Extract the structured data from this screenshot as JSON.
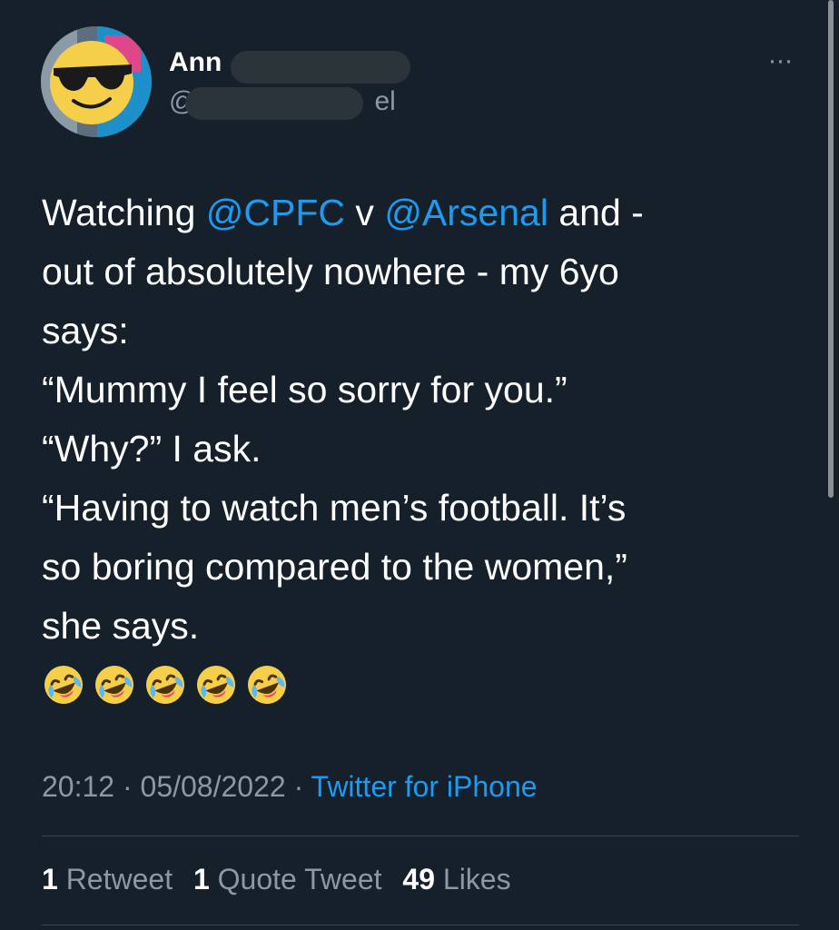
{
  "author": {
    "display_name": "Ann",
    "handle_prefix": "@",
    "handle_suffix": "el"
  },
  "more_icon": "···",
  "tweet": {
    "lines": [
      [
        {
          "t": "Watching ",
          "m": false
        },
        {
          "t": "@CPFC",
          "m": true
        },
        {
          "t": " v ",
          "m": false
        },
        {
          "t": "@Arsenal",
          "m": true
        },
        {
          "t": " and -",
          "m": false
        }
      ],
      [
        {
          "t": "out of absolutely nowhere - my 6yo",
          "m": false
        }
      ],
      [
        {
          "t": "says:",
          "m": false
        }
      ],
      [
        {
          "t": "“Mummy I feel so sorry for you.”",
          "m": false
        }
      ],
      [
        {
          "t": "“Why?” I ask.",
          "m": false
        }
      ],
      [
        {
          "t": "“Having to watch men’s football. It’s",
          "m": false
        }
      ],
      [
        {
          "t": "so boring compared to the women,”",
          "m": false
        }
      ],
      [
        {
          "t": "she says.",
          "m": false
        }
      ]
    ],
    "emoji": [
      "rolling-on-floor-laughing",
      "rolling-on-floor-laughing",
      "rolling-on-floor-laughing",
      "rolling-on-floor-laughing",
      "rolling-on-floor-laughing"
    ]
  },
  "meta": {
    "time": "20:12",
    "sep1": " · ",
    "date": "05/08/2022",
    "sep2": " · ",
    "source": "Twitter for iPhone"
  },
  "stats": {
    "retweets_count": "1",
    "retweets_label": " Retweet",
    "quotes_count": "1",
    "quotes_label": " Quote Tweet",
    "likes_count": "49",
    "likes_label": " Likes"
  },
  "colors": {
    "background": "#15202b",
    "link": "#1d9bf0",
    "secondary_text": "#8b98a5",
    "divider": "#38444d"
  }
}
